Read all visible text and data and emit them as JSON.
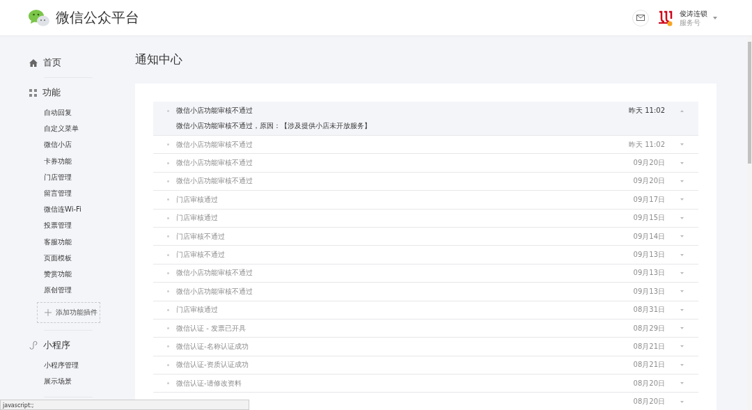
{
  "header": {
    "title": "微信公众平台",
    "account": {
      "name": "俊涛连锁",
      "type": "服务号"
    }
  },
  "sidebar": {
    "sections": [
      {
        "kind": "home",
        "label": "首页"
      },
      {
        "kind": "features",
        "label": "功能",
        "items": [
          "自动回复",
          "自定义菜单",
          "微信小店",
          "卡券功能",
          "门店管理",
          "留言管理",
          "微信连Wi-Fi",
          "投票管理",
          "客服功能",
          "页面模板",
          "赞赏功能",
          "原创管理"
        ],
        "add_button": "添加功能插件"
      },
      {
        "kind": "miniprogram",
        "label": "小程序",
        "items": [
          "小程序管理",
          "展示场景"
        ]
      }
    ]
  },
  "page_title": "通知中心",
  "notifications": [
    {
      "title": "微信小店功能审核不通过",
      "time": "昨天 11:02",
      "expanded": true,
      "detail": "微信小店功能审核不通过，原因：【涉及提供小店未开放服务】"
    },
    {
      "title": "微信小店功能审核不通过",
      "time": "昨天 11:02",
      "expanded": false
    },
    {
      "title": "微信小店功能审核不通过",
      "time": "09月20日",
      "expanded": false
    },
    {
      "title": "微信小店功能审核不通过",
      "time": "09月20日",
      "expanded": false
    },
    {
      "title": "门店审核通过",
      "time": "09月17日",
      "expanded": false
    },
    {
      "title": "门店审核通过",
      "time": "09月15日",
      "expanded": false
    },
    {
      "title": "门店审核不通过",
      "time": "09月14日",
      "expanded": false
    },
    {
      "title": "门店审核不通过",
      "time": "09月13日",
      "expanded": false
    },
    {
      "title": "微信小店功能审核不通过",
      "time": "09月13日",
      "expanded": false
    },
    {
      "title": "微信小店功能审核不通过",
      "time": "09月13日",
      "expanded": false
    },
    {
      "title": "门店审核通过",
      "time": "08月31日",
      "expanded": false
    },
    {
      "title": "微信认证 - 发票已开具",
      "time": "08月29日",
      "expanded": false
    },
    {
      "title": "微信认证-名称认证成功",
      "time": "08月21日",
      "expanded": false
    },
    {
      "title": "微信认证-资质认证成功",
      "time": "08月21日",
      "expanded": false
    },
    {
      "title": "微信认证-请修改资料",
      "time": "08月20日",
      "expanded": false
    },
    {
      "time": "08月20日",
      "expanded": false
    }
  ],
  "status_bar": "javascript:;"
}
